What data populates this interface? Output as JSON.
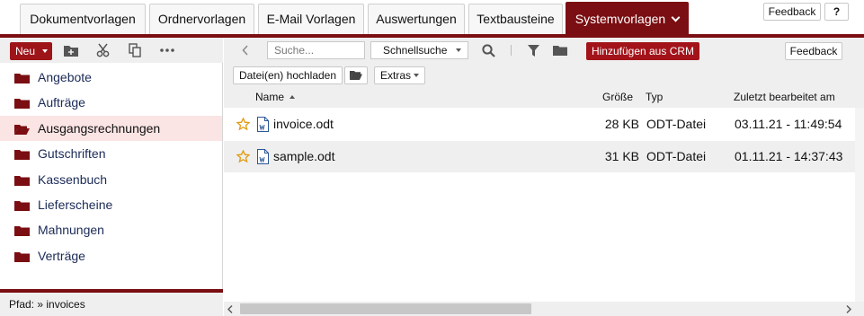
{
  "tabs": [
    {
      "label": "Dokumentvorlagen",
      "active": false
    },
    {
      "label": "Ordnervorlagen",
      "active": false
    },
    {
      "label": "E-Mail Vorlagen",
      "active": false
    },
    {
      "label": "Auswertungen",
      "active": false
    },
    {
      "label": "Textbausteine",
      "active": false
    },
    {
      "label": "Systemvorlagen",
      "active": true
    }
  ],
  "header_buttons": {
    "feedback": "Feedback",
    "help": "?"
  },
  "left": {
    "new_label": "Neu",
    "folders": [
      {
        "label": "Angebote",
        "selected": false
      },
      {
        "label": "Aufträge",
        "selected": false
      },
      {
        "label": "Ausgangsrechnungen",
        "selected": true
      },
      {
        "label": "Gutschriften",
        "selected": false
      },
      {
        "label": "Kassenbuch",
        "selected": false
      },
      {
        "label": "Lieferscheine",
        "selected": false
      },
      {
        "label": "Mahnungen",
        "selected": false
      },
      {
        "label": "Verträge",
        "selected": false
      }
    ],
    "path": "Pfad: » invoices"
  },
  "right": {
    "search_placeholder": "Suche...",
    "quicksearch": "Schnellsuche",
    "crm_button": "Hinzufügen aus CRM",
    "feedback": "Feedback",
    "upload": "Datei(en) hochladen",
    "extras": "Extras",
    "columns": {
      "name": "Name",
      "size": "Größe",
      "type": "Typ",
      "modified": "Zuletzt bearbeitet am"
    },
    "files": [
      {
        "name": "invoice.odt",
        "size": "28 KB",
        "type": "ODT-Datei",
        "modified": "03.11.21 - 11:49:54"
      },
      {
        "name": "sample.odt",
        "size": "31 KB",
        "type": "ODT-Datei",
        "modified": "01.11.21 - 14:37:43"
      }
    ]
  },
  "colors": {
    "accent": "#7a0e12",
    "button_red": "#a3141a",
    "selected_row": "#fbe4e4",
    "toolbar_gray": "#efefef",
    "folder_link": "#1b2a57"
  }
}
